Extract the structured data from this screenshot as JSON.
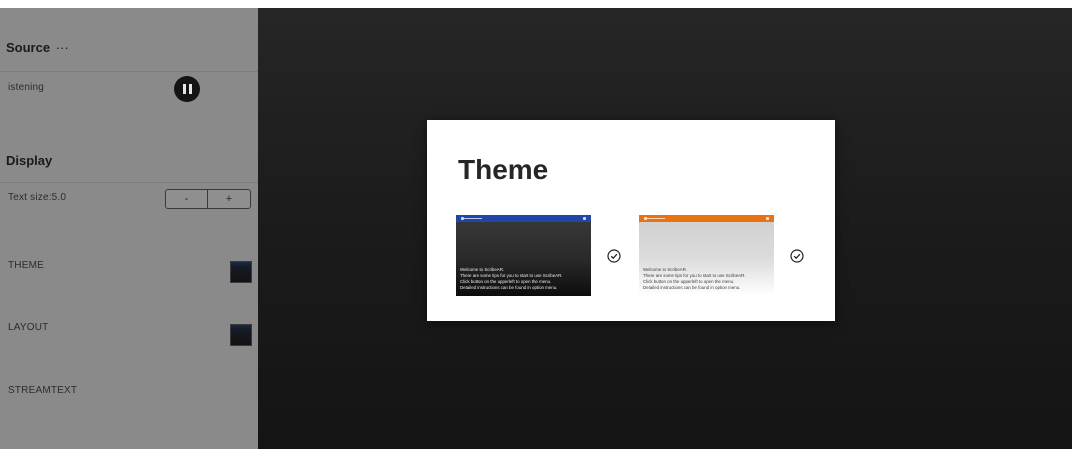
{
  "sidebar": {
    "source": {
      "title": "Source",
      "more_icon": "···"
    },
    "listening_label": "istening",
    "display": {
      "title": "Display"
    },
    "text_size_label": "Text size:5.0",
    "decrease_label": "-",
    "increase_label": "+",
    "items": [
      {
        "label": "THEME"
      },
      {
        "label": "LAYOUT"
      },
      {
        "label": "STREAMTEXT"
      }
    ]
  },
  "dialog": {
    "title": "Theme",
    "themes": [
      {
        "name": "dark",
        "header_color": "#1f47a8",
        "lines": [
          "Welcome to ScribeAR.",
          "There are some tips for you to start to use ScribeAR.",
          "Click button on the upperleft to open the menu.",
          "Detailed instructions can be found in option menu."
        ]
      },
      {
        "name": "light",
        "header_color": "#e97310",
        "lines": [
          "Welcome to ScribeAR.",
          "There are some tips for you to start to use ScribeAR.",
          "Click button on the upperleft to open the menu.",
          "Detailed instructions can be found in option menu."
        ]
      }
    ]
  },
  "icons": {
    "pause": "pause-icon",
    "check": "check-circle-icon"
  }
}
